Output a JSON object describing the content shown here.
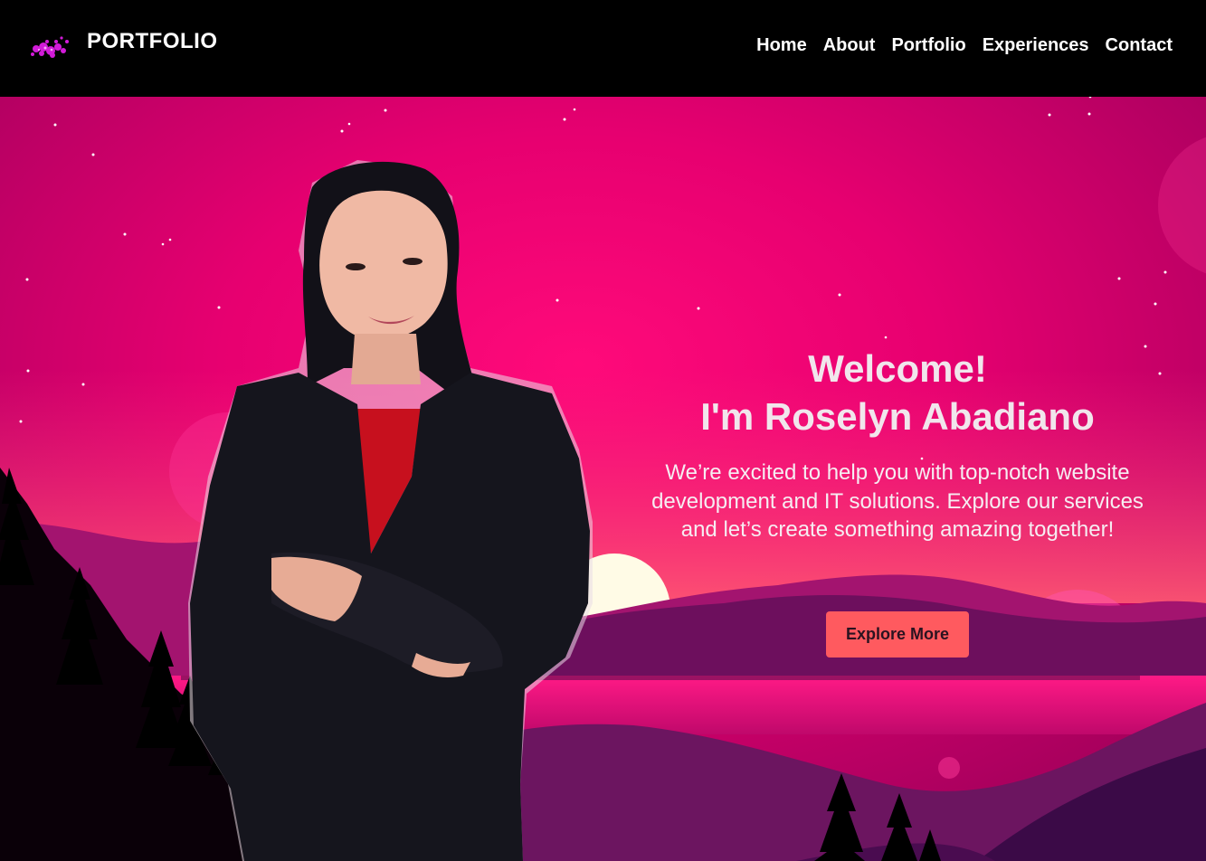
{
  "header": {
    "brand": "PORTFOLIO",
    "logo_icon": "sparkle-cluster-icon",
    "nav": [
      {
        "label": "Home"
      },
      {
        "label": "About"
      },
      {
        "label": "Portfolio"
      },
      {
        "label": "Experiences"
      },
      {
        "label": "Contact"
      }
    ]
  },
  "hero": {
    "title_line1": "Welcome!",
    "title_line2": "I'm Roselyn Abadiano",
    "subtitle": "We’re excited to help you with top-notch website development and IT solutions. Explore our services and let’s create something amazing together!",
    "cta_label": "Explore More"
  },
  "colors": {
    "sky_top": "#a1005d",
    "sky_mid": "#ff0a78",
    "sun": "#fffbe6",
    "cta": "#ff5a5f"
  }
}
